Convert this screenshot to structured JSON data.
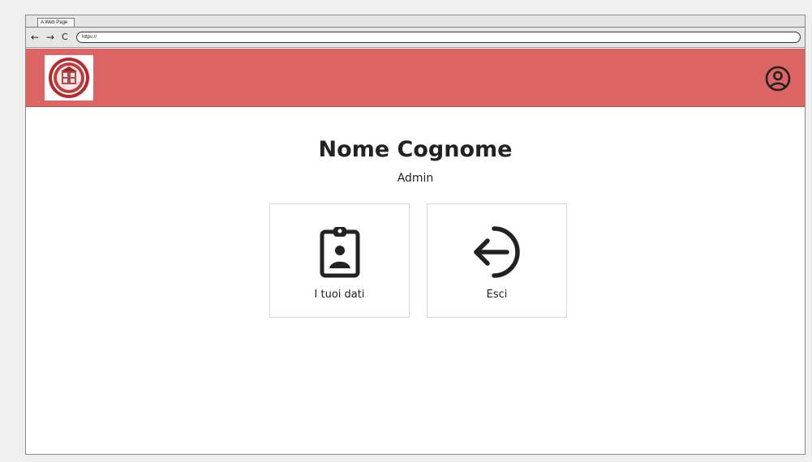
{
  "browser": {
    "tab_title": "A Web Page",
    "back_glyph": "←",
    "forward_glyph": "→",
    "reload_glyph": "C",
    "url": "https://"
  },
  "header": {
    "background_color": "#dd6464",
    "logo_icon": "university-seal-icon",
    "account_icon": "user-circle-icon"
  },
  "profile": {
    "name": "Nome Cognome",
    "role": "Admin"
  },
  "cards": [
    {
      "label": "I tuoi dati",
      "icon": "id-badge-icon"
    },
    {
      "label": "Esci",
      "icon": "logout-arrow-icon"
    }
  ]
}
